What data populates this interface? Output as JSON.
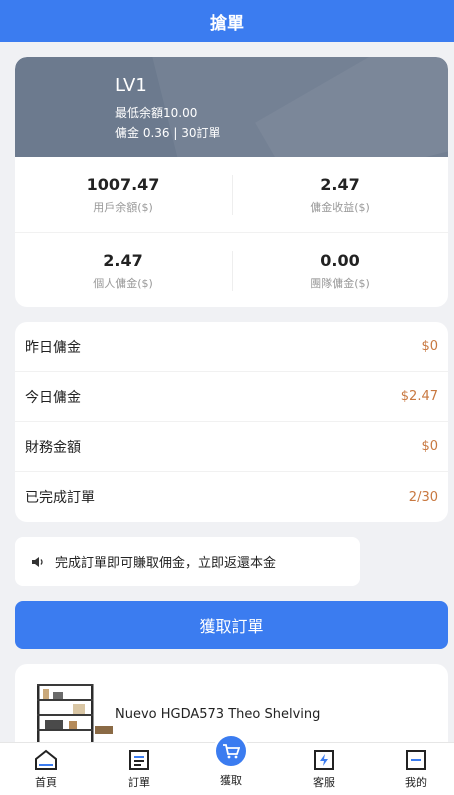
{
  "header": {
    "title": "搶單"
  },
  "level": {
    "name": "LV1",
    "min_balance": "最低余額10.00",
    "commission": "傭金 0.36 | 30訂單"
  },
  "stats": [
    {
      "value": "1007.47",
      "label": "用戶余額($)"
    },
    {
      "value": "2.47",
      "label": "傭金收益($)"
    },
    {
      "value": "2.47",
      "label": "個人傭金($)"
    },
    {
      "value": "0.00",
      "label": "團隊傭金($)"
    }
  ],
  "summary": [
    {
      "label": "昨日傭金",
      "value": "$0"
    },
    {
      "label": "今日傭金",
      "value": "$2.47"
    },
    {
      "label": "財務金額",
      "value": "$0"
    },
    {
      "label": "已完成訂單",
      "value": "2/30"
    }
  ],
  "notice": {
    "text": "完成訂單即可賺取佣金，立即返還本金",
    "icon": "speaker-icon"
  },
  "grab_button": {
    "label": "獲取訂單"
  },
  "product": {
    "name": "Nuevo HGDA573 Theo Shelving"
  },
  "tabbar": [
    {
      "label": "首頁",
      "icon": "home-icon"
    },
    {
      "label": "訂單",
      "icon": "orders-icon"
    },
    {
      "label": "獲取",
      "icon": "cart-icon"
    },
    {
      "label": "客服",
      "icon": "support-icon"
    },
    {
      "label": "我的",
      "icon": "profile-icon"
    }
  ],
  "colors": {
    "accent": "#3b7cf0",
    "value_orange": "#c87840",
    "banner": "#6c7a8e"
  }
}
